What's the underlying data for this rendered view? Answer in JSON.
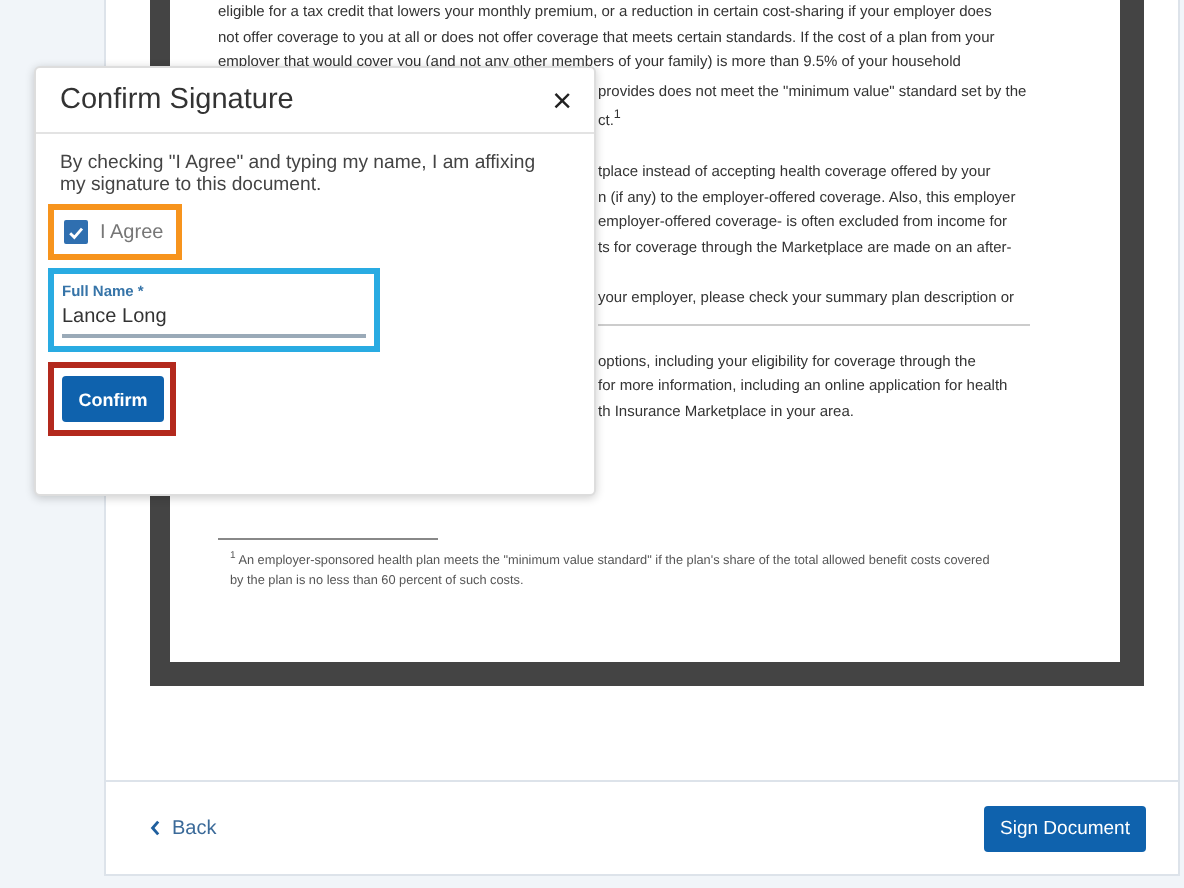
{
  "document": {
    "blocks": [
      {
        "kind": "paragraph",
        "lines": [
          "eligible for a tax credit that lowers your monthly premium, or a reduction in certain cost-sharing if your employer does",
          "not offer coverage to you at all or does not offer coverage that meets certain standards. If the cost of a plan from your",
          "employer that would cover you (and not any other members of your family) is more than 9.5% of your household"
        ]
      },
      {
        "kind": "covered_paragraph",
        "lines": [
          "provides does not meet the \"minimum value\" standard set by the",
          "ct.$^{1}$"
        ]
      },
      {
        "kind": "covered_paragraph",
        "lines": [
          "tplace instead of accepting health coverage offered by your",
          "n (if any) to the employer-offered coverage. Also, this employer",
          "employer-offered coverage- is often excluded from income for",
          "ts for coverage through the Marketplace are made on an after-"
        ]
      },
      {
        "kind": "covered_paragraph",
        "lines": [
          "your employer, please check your summary plan description or"
        ]
      },
      {
        "kind": "rule"
      },
      {
        "kind": "covered_paragraph",
        "lines": [
          "options, including your eligibility for coverage through the",
          "for more information, including an online application for health",
          "th Insurance Marketplace in your area."
        ]
      },
      {
        "kind": "footnote",
        "mark": "1",
        "lines": [
          "An employer-sponsored health plan meets the \"minimum value standard\" if the plan's share of the total allowed benefit costs covered",
          "by the plan is no less than 60 percent of such costs."
        ]
      }
    ]
  },
  "dialog": {
    "title": "Confirm Signature",
    "close": "×",
    "text": "By checking \"I Agree\" and typing my name, I am affixing my signature to this document.",
    "agree": {
      "label": "I Agree",
      "checked": true
    },
    "name_field": {
      "label": "Full Name *",
      "value": "Lance Long"
    },
    "confirm": "Confirm"
  },
  "footer": {
    "back": "Back",
    "sign": "Sign Document"
  }
}
